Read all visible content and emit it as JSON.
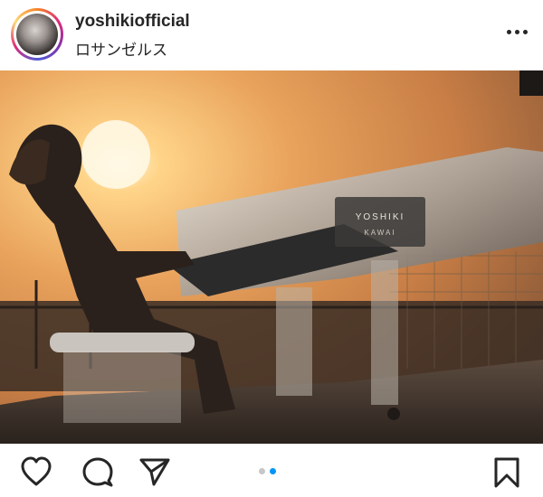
{
  "post": {
    "username": "yoshikiofficial",
    "location": "ロサンゼルス",
    "image": {
      "piano_brand_top": "YOSHIKI",
      "piano_brand_bottom": "KAWAI"
    }
  },
  "icons": {
    "more": "more-options-icon",
    "like": "heart-icon",
    "comment": "comment-icon",
    "share": "send-icon",
    "save": "bookmark-icon"
  },
  "carousel": {
    "total": 2,
    "active_index": 1,
    "active_color": "#0095f6",
    "inactive_color": "#c7c7c7"
  }
}
